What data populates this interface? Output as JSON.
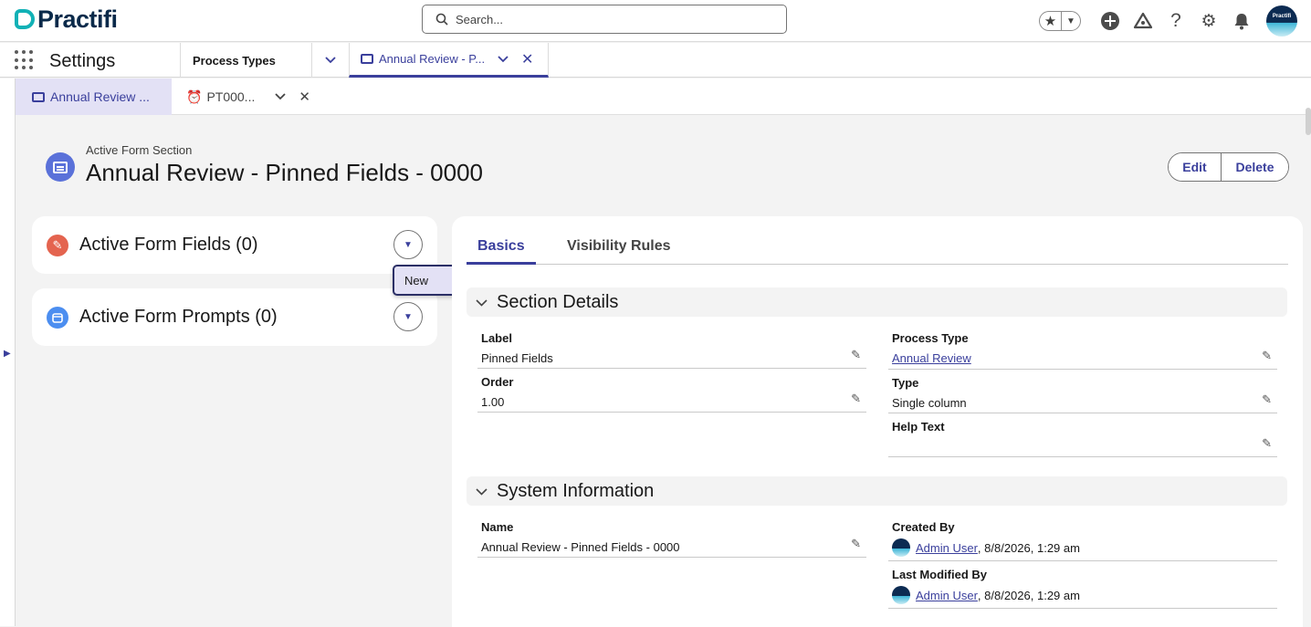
{
  "header": {
    "logo_text": "Practifi",
    "search_placeholder": "Search...",
    "avatar_text": "Practifi"
  },
  "nav": {
    "app_name": "Settings",
    "process_types": "Process Types",
    "active_tab": "Annual Review - P..."
  },
  "subtabs": {
    "active": "Annual Review ...",
    "second": "PT000..."
  },
  "record": {
    "type_label": "Active Form Section",
    "title": "Annual Review - Pinned Fields - 0000",
    "edit_label": "Edit",
    "delete_label": "Delete"
  },
  "related": {
    "fields_title": "Active Form Fields (0)",
    "prompts_title": "Active Form Prompts (0)",
    "menu_item_new": "New"
  },
  "tabs": {
    "basics": "Basics",
    "visibility": "Visibility Rules"
  },
  "section_details": {
    "title": "Section Details",
    "label_label": "Label",
    "label_value": "Pinned Fields",
    "order_label": "Order",
    "order_value": "1.00",
    "process_type_label": "Process Type",
    "process_type_value": "Annual Review",
    "type_label": "Type",
    "type_value": "Single column",
    "help_text_label": "Help Text",
    "help_text_value": ""
  },
  "system_info": {
    "title": "System Information",
    "name_label": "Name",
    "name_value": "Annual Review - Pinned Fields - 0000",
    "created_by_label": "Created By",
    "created_by_user": "Admin User",
    "created_by_date": ", 8/8/2026, 1:29 am",
    "modified_by_label": "Last Modified By",
    "modified_by_user": "Admin User",
    "modified_by_date": ", 8/8/2026, 1:29 am"
  },
  "colors": {
    "accent": "#3a3f9c",
    "brand_teal": "#11b1b6",
    "fields_icon": "#e4644f",
    "prompts_icon": "#4c8ef0",
    "record_icon": "#5a71d9"
  }
}
